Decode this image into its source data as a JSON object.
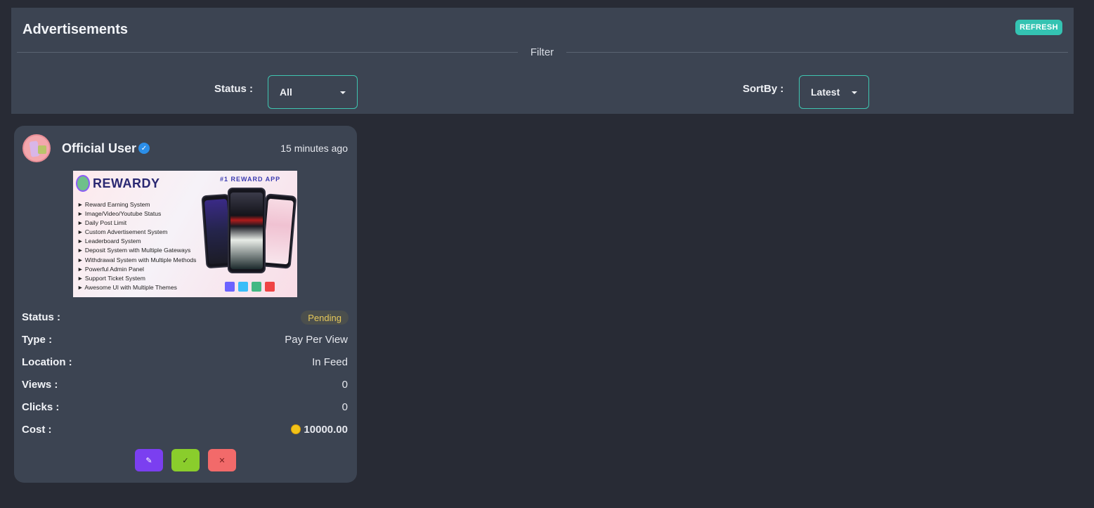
{
  "header": {
    "title": "Advertisements",
    "refresh_label": "REFRESH",
    "filter_label": "Filter"
  },
  "filters": {
    "status_label": "Status :",
    "status_value": "All",
    "sortby_label": "SortBy :",
    "sortby_value": "Latest"
  },
  "ad_card": {
    "user_name": "Official User",
    "time_ago": "15 minutes ago",
    "image": {
      "brand": "REWARDY",
      "tagline": "#1 REWARD APP",
      "features": [
        "► Reward Earning System",
        "► Image/Video/Youtube Status",
        "► Daily Post Limit",
        "► Custom Advertisement System",
        "► Leaderboard System",
        "► Deposit System with Multiple Gateways",
        "► Withdrawal System with Multiple Methods",
        "► Powerful Admin Panel",
        "► Support Ticket System",
        "► Awesome UI with Multiple Themes"
      ]
    },
    "rows": {
      "status_label": "Status :",
      "status_value": "Pending",
      "type_label": "Type :",
      "type_value": "Pay Per View",
      "location_label": "Location :",
      "location_value": "In Feed",
      "views_label": "Views :",
      "views_value": "0",
      "clicks_label": "Clicks :",
      "clicks_value": "0",
      "cost_label": "Cost :",
      "cost_value": "10000.00"
    },
    "actions": {
      "edit_icon": "✎",
      "approve_icon": "✓",
      "reject_icon": "✕"
    }
  },
  "colors": {
    "page_bg": "#282b35",
    "panel_bg": "#3c4452",
    "accent": "#34c3b2",
    "edit": "#7b3ff0",
    "approve": "#8acd2c",
    "reject": "#f26a6a",
    "pending": "#e7c95a"
  }
}
